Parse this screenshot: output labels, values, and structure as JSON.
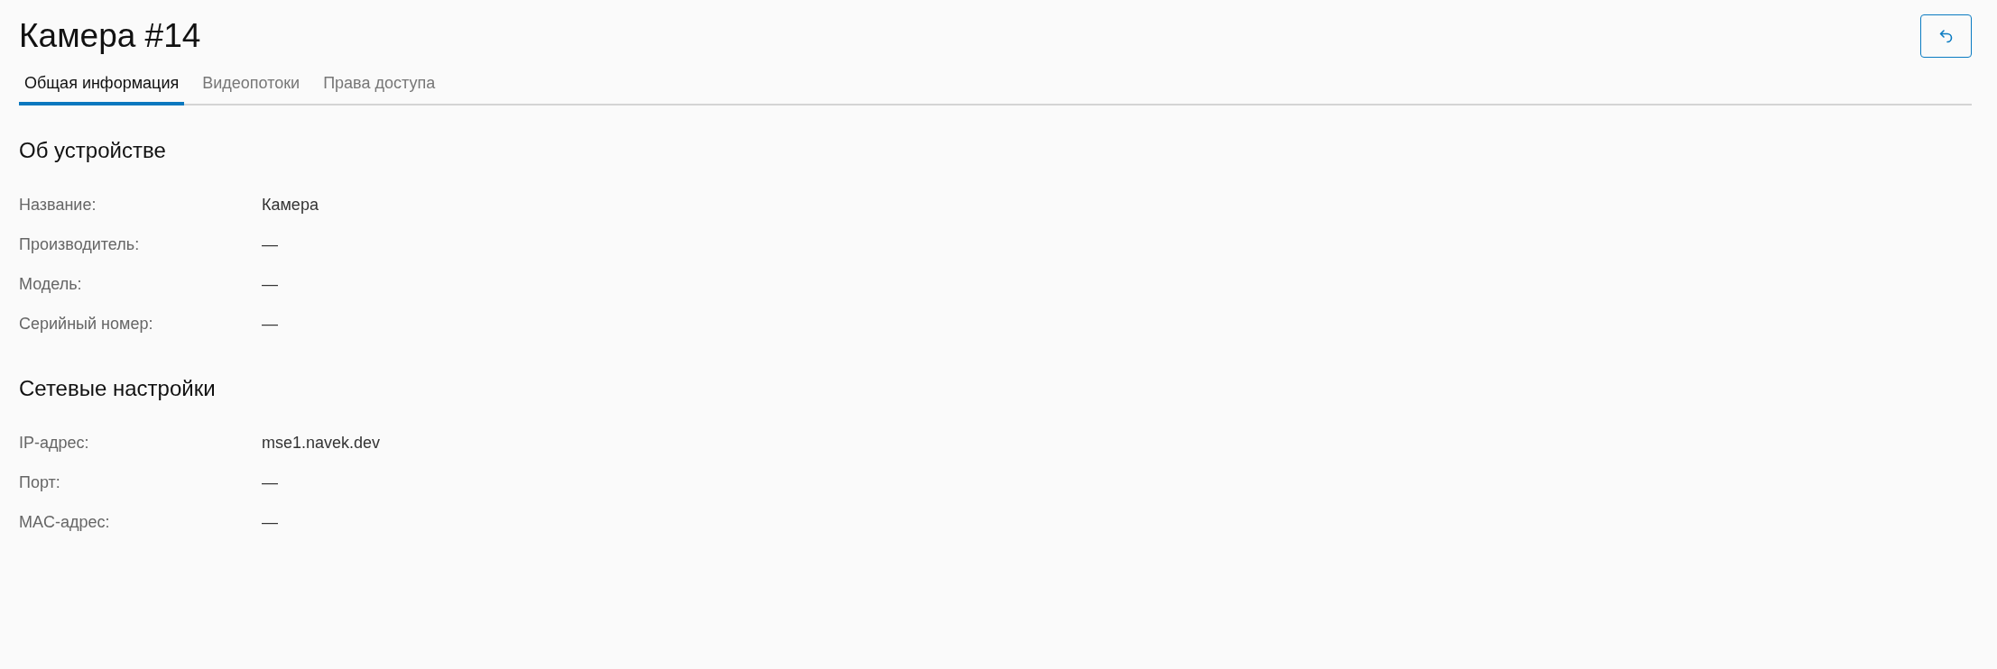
{
  "page": {
    "title": "Камера #14"
  },
  "tabs": [
    {
      "label": "Общая информация",
      "selected": true
    },
    {
      "label": "Видеопотоки",
      "selected": false
    },
    {
      "label": "Права доступа",
      "selected": false
    }
  ],
  "sections": [
    {
      "title": "Об устройстве",
      "fields": [
        {
          "label": "Название:",
          "value": "Камера"
        },
        {
          "label": "Производитель:",
          "value": "—"
        },
        {
          "label": "Модель:",
          "value": "—"
        },
        {
          "label": "Серийный номер:",
          "value": "—"
        }
      ]
    },
    {
      "title": "Сетевые настройки",
      "fields": [
        {
          "label": "IP-адрес:",
          "value": "mse1.navek.dev"
        },
        {
          "label": "Порт:",
          "value": "—"
        },
        {
          "label": "MAC-адрес:",
          "value": "—"
        }
      ]
    }
  ]
}
